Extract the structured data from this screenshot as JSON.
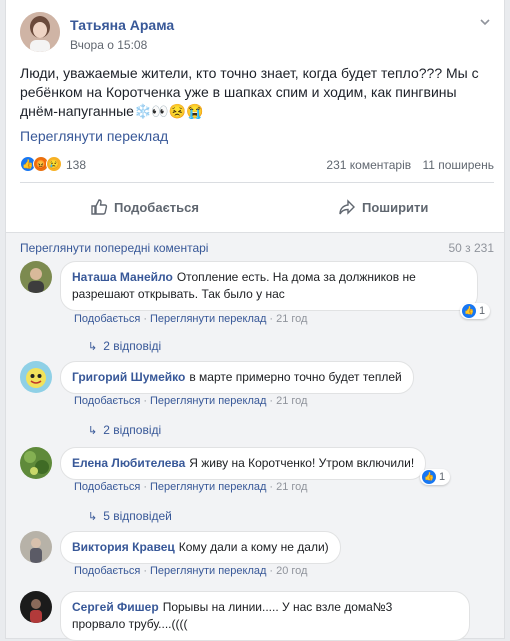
{
  "post": {
    "author": "Татьяна Арама",
    "time": "Вчора о 15:08",
    "text": "Люди, уважаемые жители, кто точно знает, когда будет тепло??? Мы с ребёнком на Коротченка уже в шапках спим и ходим, как пингвины днём-напуганные❄️👀😣😭",
    "see_translation": "Переглянути переклад",
    "reaction_count": "138",
    "comments_count": "231 коментарів",
    "shares_count": "11 поширень",
    "like_label": "Подобається",
    "share_label": "Поширити"
  },
  "comments_header": {
    "prev_link": "Переглянути попередні коментарі",
    "counter": "50 з 231"
  },
  "meta_labels": {
    "like": "Подобається",
    "translate": "Переглянути переклад"
  },
  "comments": [
    {
      "name": "Наташа Манейло",
      "text_line1": "Отопление есть. На дома за должников не",
      "text_line2": "разрешают открывать. Так было у нас",
      "time": "21 год",
      "likes": "1",
      "replies": "2 відповіді"
    },
    {
      "name": "Григорий Шумейко",
      "text_line1": "в марте примерно точно будет теплей",
      "time": "21 год",
      "replies": "2 відповіді"
    },
    {
      "name": "Елена Любителева",
      "text_line1": "Я живу на Коротченко! Утром включили!",
      "time": "21 год",
      "likes": "1",
      "replies": "5 відповідей"
    },
    {
      "name": "Виктория Кравец",
      "text_line1": "Кому дали а кому не дали)",
      "time": "20 год"
    },
    {
      "name": "Сергей Фишер",
      "text_line1": "Порывы на линии..... У нас взле дома№3",
      "text_line2": "прорвало трубу....(((("
    }
  ],
  "colors": {
    "link": "#385898",
    "like_blue": "#1877f2",
    "angry": "#e9710f",
    "sad": "#f7b125"
  },
  "icons": {
    "like": "thumbs-up-icon",
    "share": "share-arrow-icon",
    "reply": "reply-arrow-icon",
    "menu": "chevron-down-icon"
  }
}
